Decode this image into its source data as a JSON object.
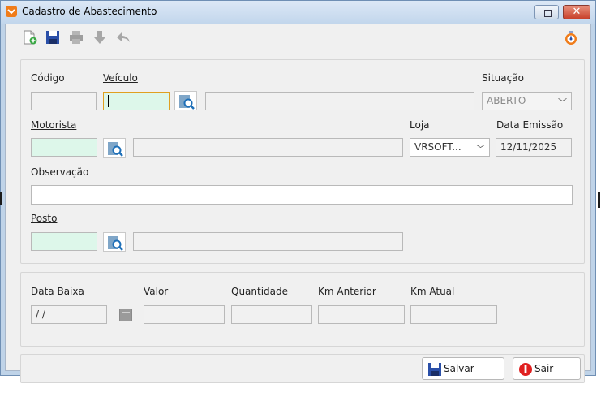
{
  "window": {
    "title": "Cadastro de Abastecimento"
  },
  "toolbar": {
    "icons": [
      "new-document-icon",
      "save-icon",
      "print-icon",
      "download-icon",
      "undo-icon"
    ],
    "right_icon": "timer-icon"
  },
  "form": {
    "codigo": {
      "label": "Código",
      "value": ""
    },
    "veiculo": {
      "label": "Veículo",
      "value": "",
      "description": ""
    },
    "situacao": {
      "label": "Situação",
      "value": "ABERTO"
    },
    "motorista": {
      "label": "Motorista",
      "value": "",
      "description": ""
    },
    "loja": {
      "label": "Loja",
      "value": "VRSOFT..."
    },
    "data_emissao": {
      "label": "Data Emissão",
      "value": "12/11/2025"
    },
    "observacao": {
      "label": "Observação",
      "value": ""
    },
    "posto": {
      "label": "Posto",
      "value": "",
      "description": ""
    }
  },
  "baixa": {
    "data_baixa": {
      "label": "Data Baixa",
      "value": " / /"
    },
    "valor": {
      "label": "Valor",
      "value": ""
    },
    "quantidade": {
      "label": "Quantidade",
      "value": ""
    },
    "km_anterior": {
      "label": "Km Anterior",
      "value": ""
    },
    "km_atual": {
      "label": "Km Atual",
      "value": ""
    }
  },
  "footer": {
    "save_label": "Salvar",
    "exit_label": "Sair"
  },
  "colors": {
    "required_field": "#ddf7ea",
    "accent_orange": "#f07c1a",
    "close_red": "#c8412c",
    "save_blue": "#2a4fa8",
    "exit_red": "#e02020"
  }
}
